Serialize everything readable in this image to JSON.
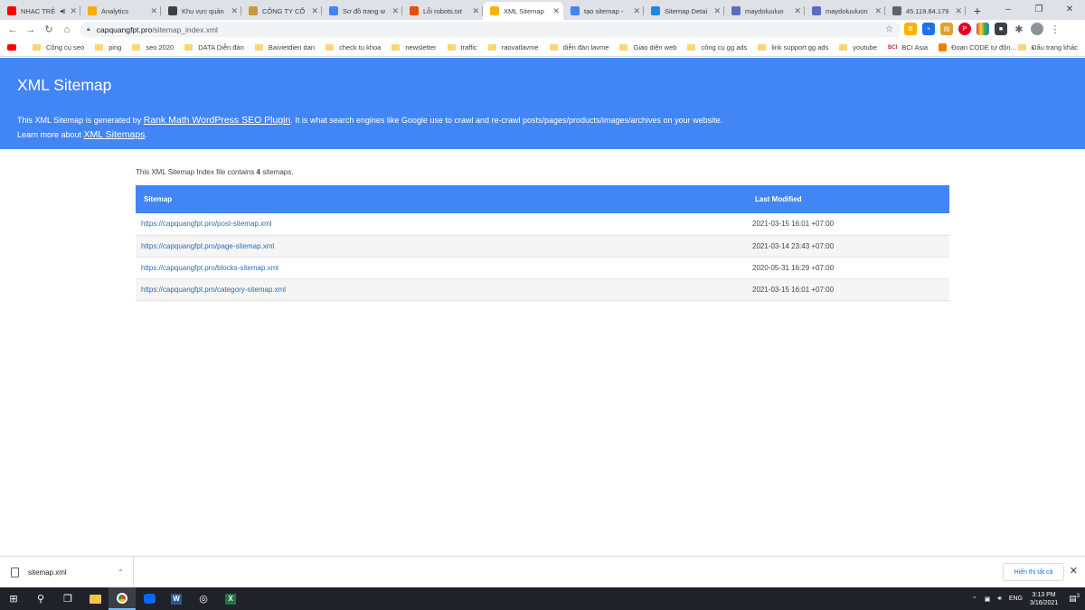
{
  "browser": {
    "tabs": [
      {
        "label": "NHẠC TRẺ",
        "favicon": "youtube-icon",
        "color": "#ff0000",
        "active": false,
        "audio": true
      },
      {
        "label": "Analytics",
        "favicon": "analytics-icon",
        "color": "#f9ab00",
        "active": false
      },
      {
        "label": "Khu vực quản",
        "favicon": "wordpress-icon",
        "color": "#3c4043",
        "active": false
      },
      {
        "label": "CÔNG TY CỔ",
        "favicon": "company-icon",
        "color": "#c49a3a",
        "active": false
      },
      {
        "label": "Sơ đồ trang w",
        "favicon": "search-console-icon",
        "color": "#4285f4",
        "active": false
      },
      {
        "label": "Lỗi robots.txt",
        "favicon": "dvi-icon",
        "color": "#e65100",
        "active": false
      },
      {
        "label": "XML Sitemap",
        "favicon": "rank-math-icon",
        "color": "#f4b400",
        "active": true
      },
      {
        "label": "tạo sitemap -",
        "favicon": "google-icon",
        "color": "#4285f4",
        "active": false
      },
      {
        "label": "Sitemap Detai",
        "favicon": "sitemap-icon",
        "color": "#1e88e5",
        "active": false
      },
      {
        "label": "maydoluuluo",
        "favicon": "maydo-icon",
        "color": "#5c6bc0",
        "active": false
      },
      {
        "label": "maydoluuluon",
        "favicon": "maydo-icon",
        "color": "#5c6bc0",
        "active": false
      },
      {
        "label": "45.119.84.179",
        "favicon": "globe-icon",
        "color": "#5f6368",
        "active": false
      }
    ],
    "address": {
      "host": "capquangfpt.pro",
      "path": "/sitemap_index.xml"
    },
    "bookmarks": [
      {
        "label": "",
        "icon": "youtube"
      },
      {
        "label": "Công cụ seo",
        "icon": "folder"
      },
      {
        "label": "ping",
        "icon": "folder"
      },
      {
        "label": "seo 2020",
        "icon": "folder"
      },
      {
        "label": "DATA Diễn đàn",
        "icon": "folder"
      },
      {
        "label": "Baivietdien dan",
        "icon": "folder"
      },
      {
        "label": "check tu khoa",
        "icon": "folder"
      },
      {
        "label": "newsletter",
        "icon": "folder"
      },
      {
        "label": "traffic",
        "icon": "folder"
      },
      {
        "label": "raovatlavme",
        "icon": "folder"
      },
      {
        "label": "diễn đàn lavme",
        "icon": "folder"
      },
      {
        "label": "Giao diện web",
        "icon": "folder"
      },
      {
        "label": "công cụ gg ads",
        "icon": "folder"
      },
      {
        "label": "link support gg ads",
        "icon": "folder"
      },
      {
        "label": "youtube",
        "icon": "folder"
      },
      {
        "label": "BCI Asia",
        "icon": "bci"
      },
      {
        "label": "Đoạn CODE tự độn...",
        "icon": "blogger"
      }
    ],
    "bookmarks_more": "»",
    "other_bookmarks": "Dấu trang khác"
  },
  "page": {
    "title": "XML Sitemap",
    "intro_before": "This XML Sitemap is generated by ",
    "intro_link": "Rank Math WordPress SEO Plugin",
    "intro_after": ". It is what search engines like Google use to crawl and re-crawl posts/pages/products/images/archives on your website.",
    "learn_before": "Learn more about ",
    "learn_link": "XML Sitemaps",
    "learn_after": ".",
    "summary_before": "This XML Sitemap Index file contains ",
    "summary_count": "4",
    "summary_after": " sitemaps.",
    "columns": {
      "sitemap": "Sitemap",
      "last_modified": "Last Modified"
    },
    "rows": [
      {
        "url": "https://capquangfpt.pro/post-sitemap.xml",
        "modified": "2021-03-15 16:01 +07:00"
      },
      {
        "url": "https://capquangfpt.pro/page-sitemap.xml",
        "modified": "2021-03-14 23:43 +07:00"
      },
      {
        "url": "https://capquangfpt.pro/blocks-sitemap.xml",
        "modified": "2020-05-31 16:29 +07:00"
      },
      {
        "url": "https://capquangfpt.pro/category-sitemap.xml",
        "modified": "2021-03-15 16:01 +07:00"
      }
    ]
  },
  "downloads": {
    "file": "sitemap.xml",
    "show_all": "Hiển thị tất cả"
  },
  "taskbar": {
    "lang": "ENG",
    "time": "3:13 PM",
    "date": "3/16/2021",
    "notification_count": "3"
  },
  "colors": {
    "accent": "#4285f4",
    "link": "#2a6fb8"
  }
}
